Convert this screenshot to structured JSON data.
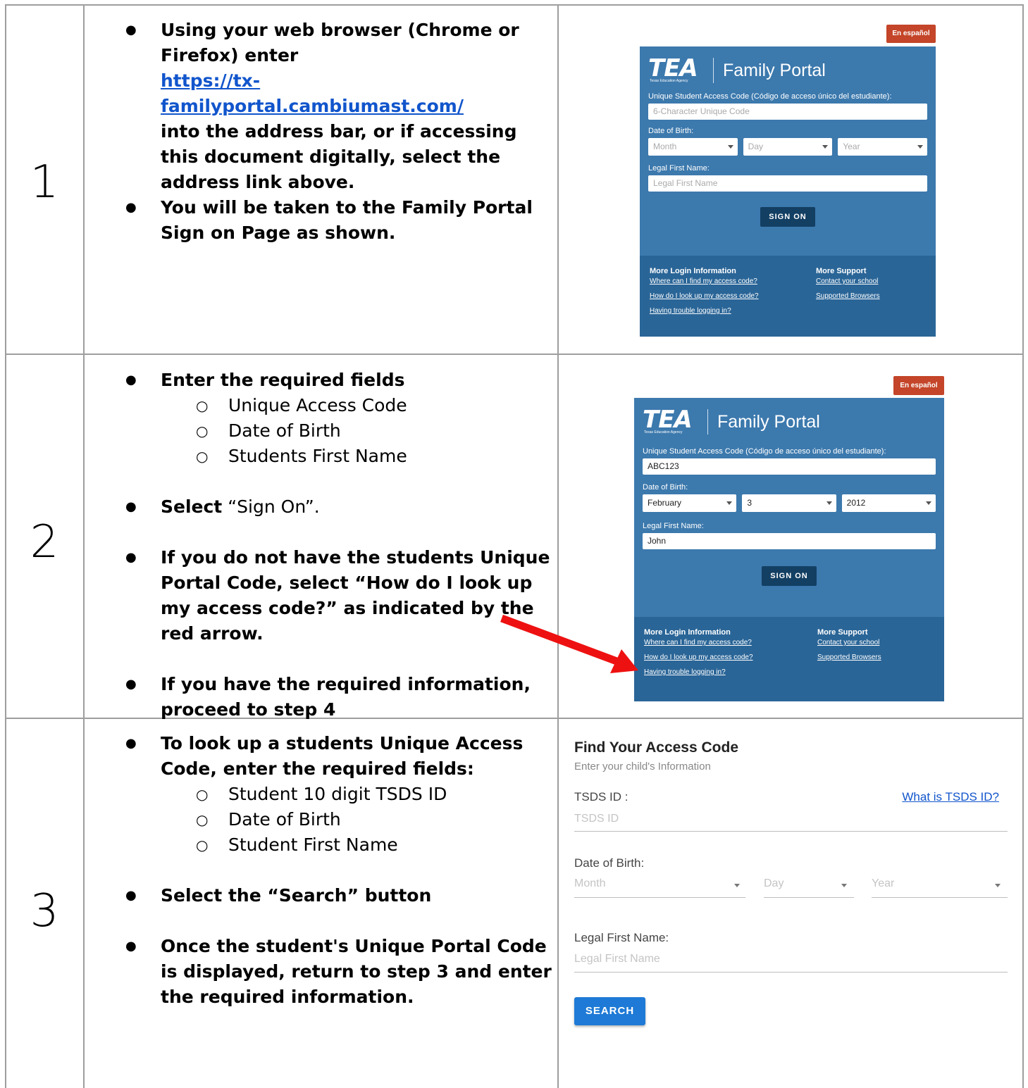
{
  "steps": [
    {
      "number": "1",
      "bullets": [
        {
          "pre": "Using your web browser (Chrome or Firefox) enter",
          "link": "https://tx-familyportal.cambiumast.com/",
          "post": "into the address bar, or if accessing this document digitally, select the address link above."
        },
        {
          "text": "You will be taken to the Family Portal Sign on Page as shown."
        }
      ]
    },
    {
      "number": "2",
      "bullets": [
        {
          "text": "Enter the required fields",
          "sub": [
            "Unique Access Code",
            "Date of Birth",
            "Students First Name"
          ]
        },
        {
          "bold": "Select",
          "plain": " “Sign On”."
        },
        {
          "text": "If you do not have the students Unique Portal Code, select “How do I look up my access code?” as indicated by the red arrow."
        },
        {
          "text": "If you have the required information, proceed to step 4"
        }
      ]
    },
    {
      "number": "3",
      "bullets": [
        {
          "text": "To look up a students Unique Access Code, enter the required fields:",
          "sub": [
            "Student 10 digit TSDS ID",
            "Date of Birth",
            "Student First Name"
          ]
        },
        {
          "text": "Select the “Search” button"
        },
        {
          "text": "Once the student's Unique Portal Code is displayed, return to step 3 and enter the required information."
        }
      ]
    }
  ],
  "portal": {
    "espanol": "En español",
    "logo": "TEA",
    "logo_sub": "Texas Education Agency",
    "title": "Family Portal",
    "code_label": "Unique Student Access Code (Código de acceso único del estudiante):",
    "code_placeholder": "6-Character Unique Code",
    "dob_label": "Date of Birth:",
    "month_placeholder": "Month",
    "day_placeholder": "Day",
    "year_placeholder": "Year",
    "name_label": "Legal First Name:",
    "name_placeholder": "Legal First Name",
    "signon": "SIGN ON",
    "more_login": "More Login Information",
    "link_where": "Where can I find my access code?",
    "link_how": "How do I look up my access code?",
    "link_trouble": "Having trouble logging in?",
    "more_support": "More Support",
    "link_contact": "Contact your school",
    "link_browsers": "Supported Browsers"
  },
  "portal_filled": {
    "code_value": "ABC123",
    "month_value": "February",
    "day_value": "3",
    "year_value": "2012",
    "name_value": "John"
  },
  "find": {
    "title": "Find Your Access Code",
    "subtitle": "Enter your child's Information",
    "tsds_label": "TSDS ID :",
    "what_is": "What is TSDS ID?",
    "tsds_placeholder": "TSDS ID",
    "dob_label": "Date of Birth:",
    "month": "Month",
    "day": "Day",
    "year": "Year",
    "name_label": "Legal First Name:",
    "name_placeholder": "Legal First Name",
    "search": "SEARCH"
  },
  "colors": {
    "portal_blue": "#3c79ad",
    "portal_footer": "#2a6597",
    "signon_btn": "#133f63",
    "espanol_btn": "#c44529",
    "arrow": "#ee1111",
    "search_btn": "#1e7ad6",
    "link": "#1155cc"
  }
}
